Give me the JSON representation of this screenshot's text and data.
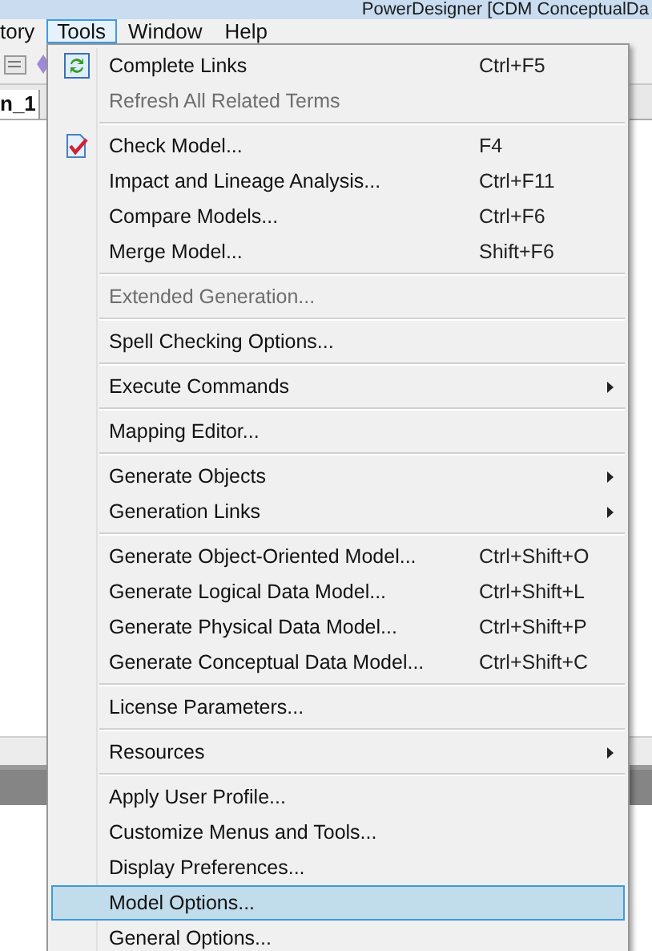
{
  "window": {
    "title": "PowerDesigner [CDM ConceptualDa"
  },
  "menubar": [
    {
      "label": "tory",
      "selected": false
    },
    {
      "label": "Tools",
      "selected": true
    },
    {
      "label": "Window",
      "selected": false
    },
    {
      "label": "Help",
      "selected": false
    }
  ],
  "tab": {
    "label": "n_1"
  },
  "menu": [
    {
      "kind": "links",
      "label": "Complete Links",
      "shortcut": "Ctrl+F5",
      "disabled": false,
      "submenu": false,
      "selected": false
    },
    {
      "kind": "item",
      "label": "Refresh All Related Terms",
      "disabled": true,
      "submenu": false,
      "selected": false
    },
    {
      "kind": "separator"
    },
    {
      "kind": "check",
      "label": "Check Model...",
      "shortcut": "F4",
      "disabled": false,
      "submenu": false,
      "selected": false
    },
    {
      "kind": "item",
      "label": "Impact and Lineage Analysis...",
      "shortcut": "Ctrl+F11",
      "disabled": false,
      "submenu": false,
      "selected": false
    },
    {
      "kind": "item",
      "label": "Compare Models...",
      "shortcut": "Ctrl+F6",
      "disabled": false,
      "submenu": false,
      "selected": false
    },
    {
      "kind": "item",
      "label": "Merge Model...",
      "shortcut": "Shift+F6",
      "disabled": false,
      "submenu": false,
      "selected": false
    },
    {
      "kind": "separator"
    },
    {
      "kind": "item",
      "label": "Extended Generation...",
      "disabled": true,
      "submenu": false,
      "selected": false
    },
    {
      "kind": "separator"
    },
    {
      "kind": "item",
      "label": "Spell Checking Options...",
      "disabled": false,
      "submenu": false,
      "selected": false
    },
    {
      "kind": "separator"
    },
    {
      "kind": "item",
      "label": "Execute Commands",
      "disabled": false,
      "submenu": true,
      "selected": false
    },
    {
      "kind": "separator"
    },
    {
      "kind": "item",
      "label": "Mapping Editor...",
      "disabled": false,
      "submenu": false,
      "selected": false
    },
    {
      "kind": "separator"
    },
    {
      "kind": "item",
      "label": "Generate Objects",
      "disabled": false,
      "submenu": true,
      "selected": false
    },
    {
      "kind": "item",
      "label": "Generation Links",
      "disabled": false,
      "submenu": true,
      "selected": false
    },
    {
      "kind": "separator"
    },
    {
      "kind": "item",
      "label": "Generate Object-Oriented Model...",
      "shortcut": "Ctrl+Shift+O",
      "disabled": false,
      "submenu": false,
      "selected": false
    },
    {
      "kind": "item",
      "label": "Generate Logical Data Model...",
      "shortcut": "Ctrl+Shift+L",
      "disabled": false,
      "submenu": false,
      "selected": false
    },
    {
      "kind": "item",
      "label": "Generate Physical Data Model...",
      "shortcut": "Ctrl+Shift+P",
      "disabled": false,
      "submenu": false,
      "selected": false
    },
    {
      "kind": "item",
      "label": "Generate Conceptual Data Model...",
      "shortcut": "Ctrl+Shift+C",
      "disabled": false,
      "submenu": false,
      "selected": false
    },
    {
      "kind": "separator"
    },
    {
      "kind": "item",
      "label": "License Parameters...",
      "disabled": false,
      "submenu": false,
      "selected": false
    },
    {
      "kind": "separator"
    },
    {
      "kind": "item",
      "label": "Resources",
      "disabled": false,
      "submenu": true,
      "selected": false
    },
    {
      "kind": "separator"
    },
    {
      "kind": "item",
      "label": "Apply User Profile...",
      "disabled": false,
      "submenu": false,
      "selected": false
    },
    {
      "kind": "item",
      "label": "Customize Menus and Tools...",
      "disabled": false,
      "submenu": false,
      "selected": false
    },
    {
      "kind": "item",
      "label": "Display Preferences...",
      "disabled": false,
      "submenu": false,
      "selected": false
    },
    {
      "kind": "item",
      "label": "Model Options...",
      "disabled": false,
      "submenu": false,
      "selected": true
    },
    {
      "kind": "item",
      "label": "General Options...",
      "disabled": false,
      "submenu": false,
      "selected": false
    }
  ]
}
